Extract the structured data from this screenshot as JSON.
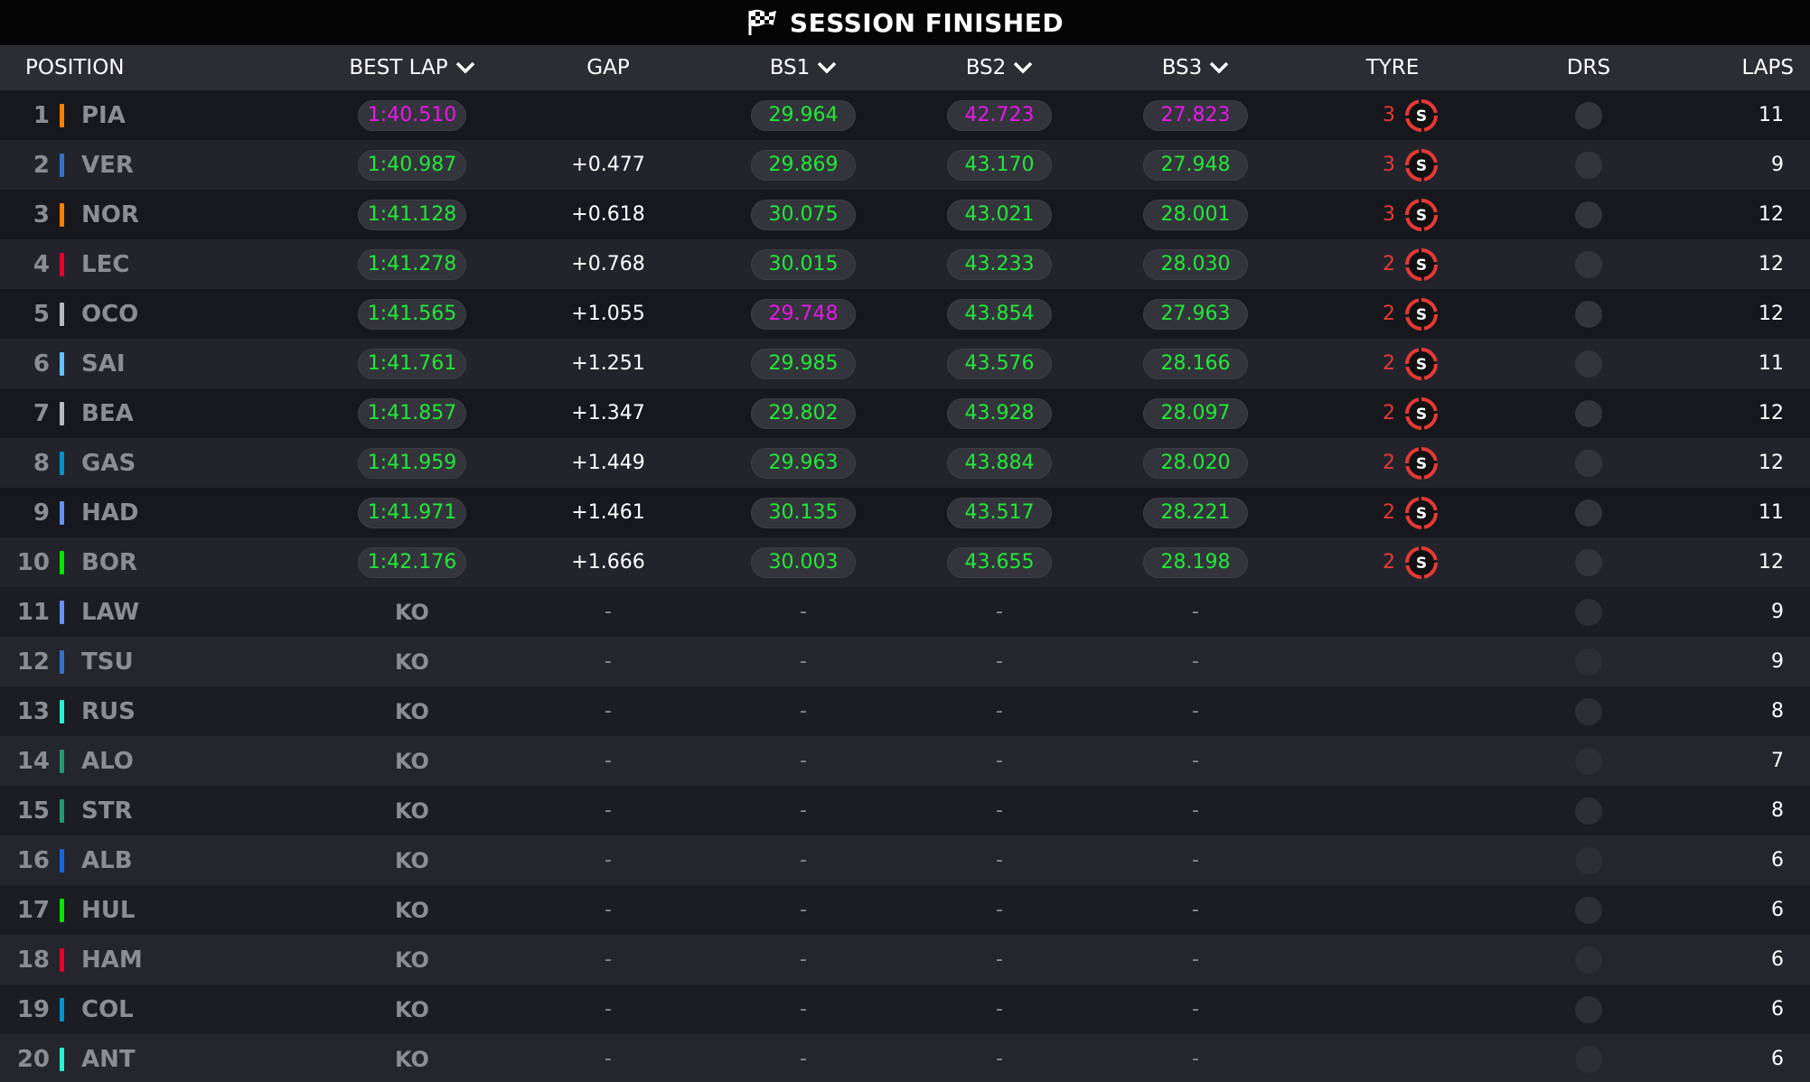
{
  "banner": {
    "title": "SESSION FINISHED",
    "icon": "checkered-flag-icon"
  },
  "columns": {
    "position": "POSITION",
    "best_lap": "BEST LAP",
    "gap": "GAP",
    "bs1": "BS1",
    "bs2": "BS2",
    "bs3": "BS3",
    "tyre": "TYRE",
    "drs": "DRS",
    "laps": "LAPS"
  },
  "colors": {
    "personal_best": "#22e639",
    "overall_best": "#e619e6",
    "soft_tyre": "#e53935"
  },
  "drivers": [
    {
      "pos": "1",
      "code": "PIA",
      "team_color": "#ff8000",
      "best": "1:40.510",
      "best_c": "purple",
      "gap": "",
      "bs1": "29.964",
      "bs1_c": "green",
      "bs2": "42.723",
      "bs2_c": "purple",
      "bs3": "27.823",
      "bs3_c": "purple",
      "tyre_laps": "3",
      "tyre": "S",
      "laps": "11"
    },
    {
      "pos": "2",
      "code": "VER",
      "team_color": "#3671c6",
      "best": "1:40.987",
      "best_c": "green",
      "gap": "+0.477",
      "bs1": "29.869",
      "bs1_c": "green",
      "bs2": "43.170",
      "bs2_c": "green",
      "bs3": "27.948",
      "bs3_c": "green",
      "tyre_laps": "3",
      "tyre": "S",
      "laps": "9"
    },
    {
      "pos": "3",
      "code": "NOR",
      "team_color": "#ff8000",
      "best": "1:41.128",
      "best_c": "green",
      "gap": "+0.618",
      "bs1": "30.075",
      "bs1_c": "green",
      "bs2": "43.021",
      "bs2_c": "green",
      "bs3": "28.001",
      "bs3_c": "green",
      "tyre_laps": "3",
      "tyre": "S",
      "laps": "12"
    },
    {
      "pos": "4",
      "code": "LEC",
      "team_color": "#e8002d",
      "best": "1:41.278",
      "best_c": "green",
      "gap": "+0.768",
      "bs1": "30.015",
      "bs1_c": "green",
      "bs2": "43.233",
      "bs2_c": "green",
      "bs3": "28.030",
      "bs3_c": "green",
      "tyre_laps": "2",
      "tyre": "S",
      "laps": "12"
    },
    {
      "pos": "5",
      "code": "OCO",
      "team_color": "#b6babd",
      "best": "1:41.565",
      "best_c": "green",
      "gap": "+1.055",
      "bs1": "29.748",
      "bs1_c": "purple",
      "bs2": "43.854",
      "bs2_c": "green",
      "bs3": "27.963",
      "bs3_c": "green",
      "tyre_laps": "2",
      "tyre": "S",
      "laps": "12"
    },
    {
      "pos": "6",
      "code": "SAI",
      "team_color": "#64c4ff",
      "best": "1:41.761",
      "best_c": "green",
      "gap": "+1.251",
      "bs1": "29.985",
      "bs1_c": "green",
      "bs2": "43.576",
      "bs2_c": "green",
      "bs3": "28.166",
      "bs3_c": "green",
      "tyre_laps": "2",
      "tyre": "S",
      "laps": "11"
    },
    {
      "pos": "7",
      "code": "BEA",
      "team_color": "#b6babd",
      "best": "1:41.857",
      "best_c": "green",
      "gap": "+1.347",
      "bs1": "29.802",
      "bs1_c": "green",
      "bs2": "43.928",
      "bs2_c": "green",
      "bs3": "28.097",
      "bs3_c": "green",
      "tyre_laps": "2",
      "tyre": "S",
      "laps": "12"
    },
    {
      "pos": "8",
      "code": "GAS",
      "team_color": "#0093cc",
      "best": "1:41.959",
      "best_c": "green",
      "gap": "+1.449",
      "bs1": "29.963",
      "bs1_c": "green",
      "bs2": "43.884",
      "bs2_c": "green",
      "bs3": "28.020",
      "bs3_c": "green",
      "tyre_laps": "2",
      "tyre": "S",
      "laps": "12"
    },
    {
      "pos": "9",
      "code": "HAD",
      "team_color": "#6692ff",
      "best": "1:41.971",
      "best_c": "green",
      "gap": "+1.461",
      "bs1": "30.135",
      "bs1_c": "green",
      "bs2": "43.517",
      "bs2_c": "green",
      "bs3": "28.221",
      "bs3_c": "green",
      "tyre_laps": "2",
      "tyre": "S",
      "laps": "11"
    },
    {
      "pos": "10",
      "code": "BOR",
      "team_color": "#00e700",
      "best": "1:42.176",
      "best_c": "green",
      "gap": "+1.666",
      "bs1": "30.003",
      "bs1_c": "green",
      "bs2": "43.655",
      "bs2_c": "green",
      "bs3": "28.198",
      "bs3_c": "green",
      "tyre_laps": "2",
      "tyre": "S",
      "laps": "12"
    },
    {
      "pos": "11",
      "code": "LAW",
      "team_color": "#6692ff",
      "best": "KO",
      "gap": "-",
      "bs1": "-",
      "bs2": "-",
      "bs3": "-",
      "tyre_laps": "",
      "tyre": "",
      "laps": "9"
    },
    {
      "pos": "12",
      "code": "TSU",
      "team_color": "#3671c6",
      "best": "KO",
      "gap": "-",
      "bs1": "-",
      "bs2": "-",
      "bs3": "-",
      "tyre_laps": "",
      "tyre": "",
      "laps": "9"
    },
    {
      "pos": "13",
      "code": "RUS",
      "team_color": "#27f4d2",
      "best": "KO",
      "gap": "-",
      "bs1": "-",
      "bs2": "-",
      "bs3": "-",
      "tyre_laps": "",
      "tyre": "",
      "laps": "8"
    },
    {
      "pos": "14",
      "code": "ALO",
      "team_color": "#229971",
      "best": "KO",
      "gap": "-",
      "bs1": "-",
      "bs2": "-",
      "bs3": "-",
      "tyre_laps": "",
      "tyre": "",
      "laps": "7"
    },
    {
      "pos": "15",
      "code": "STR",
      "team_color": "#229971",
      "best": "KO",
      "gap": "-",
      "bs1": "-",
      "bs2": "-",
      "bs3": "-",
      "tyre_laps": "",
      "tyre": "",
      "laps": "8"
    },
    {
      "pos": "16",
      "code": "ALB",
      "team_color": "#1868db",
      "best": "KO",
      "gap": "-",
      "bs1": "-",
      "bs2": "-",
      "bs3": "-",
      "tyre_laps": "",
      "tyre": "",
      "laps": "6"
    },
    {
      "pos": "17",
      "code": "HUL",
      "team_color": "#00e700",
      "best": "KO",
      "gap": "-",
      "bs1": "-",
      "bs2": "-",
      "bs3": "-",
      "tyre_laps": "",
      "tyre": "",
      "laps": "6"
    },
    {
      "pos": "18",
      "code": "HAM",
      "team_color": "#e8002d",
      "best": "KO",
      "gap": "-",
      "bs1": "-",
      "bs2": "-",
      "bs3": "-",
      "tyre_laps": "",
      "tyre": "",
      "laps": "6"
    },
    {
      "pos": "19",
      "code": "COL",
      "team_color": "#0093cc",
      "best": "KO",
      "gap": "-",
      "bs1": "-",
      "bs2": "-",
      "bs3": "-",
      "tyre_laps": "",
      "tyre": "",
      "laps": "6"
    },
    {
      "pos": "20",
      "code": "ANT",
      "team_color": "#27f4d2",
      "best": "KO",
      "gap": "-",
      "bs1": "-",
      "bs2": "-",
      "bs3": "-",
      "tyre_laps": "",
      "tyre": "",
      "laps": "6"
    }
  ]
}
